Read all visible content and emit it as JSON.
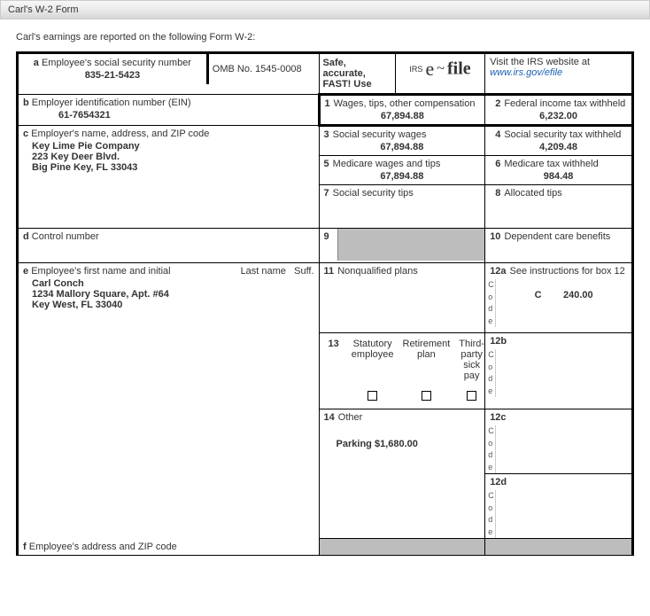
{
  "window": {
    "title": "Carl's W-2 Form"
  },
  "intro": "Carl's earnings are reported on the following Form W-2:",
  "box_a": {
    "lbl_letter": "a",
    "label": "Employee's social security number",
    "value": "835-21-5423"
  },
  "omb": "OMB No. 1545-0008",
  "safe": {
    "line1": "Safe, accurate,",
    "line2": "FAST! Use"
  },
  "efile": {
    "irs": "IRS",
    "e": "e",
    "tilde": "~",
    "file": "file"
  },
  "visit": {
    "line1": "Visit the IRS website at",
    "link": "www.irs.gov/efile"
  },
  "box_b": {
    "lbl_letter": "b",
    "label": "Employer identification number (EIN)",
    "value": "61-7654321"
  },
  "box_c": {
    "lbl_letter": "c",
    "label": "Employer's name, address, and ZIP code",
    "line1": "Key Lime Pie Company",
    "line2": "223 Key Deer Blvd.",
    "line3": "Big Pine Key, FL 33043"
  },
  "box_d": {
    "lbl_letter": "d",
    "label": "Control number"
  },
  "box_e": {
    "lbl_letter": "e",
    "label1": "Employee's first name and initial",
    "label2": "Last name",
    "label3": "Suff.",
    "line1": "Carl Conch",
    "line2": "1234 Mallory Square, Apt. #64",
    "line3": "Key West, FL 33040"
  },
  "box_f": {
    "lbl_letter": "f",
    "label": "Employee's address and ZIP code"
  },
  "box1": {
    "num": "1",
    "label": "Wages, tips, other compensation",
    "value": "67,894.88"
  },
  "box2": {
    "num": "2",
    "label": "Federal income tax withheld",
    "value": "6,232.00"
  },
  "box3": {
    "num": "3",
    "label": "Social security wages",
    "value": "67,894.88"
  },
  "box4": {
    "num": "4",
    "label": "Social security tax withheld",
    "value": "4,209.48"
  },
  "box5": {
    "num": "5",
    "label": "Medicare wages and tips",
    "value": "67,894.88"
  },
  "box6": {
    "num": "6",
    "label": "Medicare tax withheld",
    "value": "984.48"
  },
  "box7": {
    "num": "7",
    "label": "Social security tips"
  },
  "box8": {
    "num": "8",
    "label": "Allocated tips"
  },
  "box9": {
    "num": "9"
  },
  "box10": {
    "num": "10",
    "label": "Dependent care benefits"
  },
  "box11": {
    "num": "11",
    "label": "Nonqualified plans"
  },
  "box12a": {
    "num": "12a",
    "label": "See instructions for box 12",
    "code": "C",
    "value": "240.00"
  },
  "box12b": {
    "num": "12b"
  },
  "box12c": {
    "num": "12c"
  },
  "box12d": {
    "num": "12d"
  },
  "code_letters": {
    "c": "C",
    "o": "o",
    "d": "d",
    "e": "e"
  },
  "box13": {
    "num": "13",
    "c1a": "Statutory",
    "c1b": "employee",
    "c2a": "Retirement",
    "c2b": "plan",
    "c3a": "Third-party",
    "c3b": "sick pay"
  },
  "box14": {
    "num": "14",
    "label": "Other",
    "value": "Parking $1,680.00"
  }
}
